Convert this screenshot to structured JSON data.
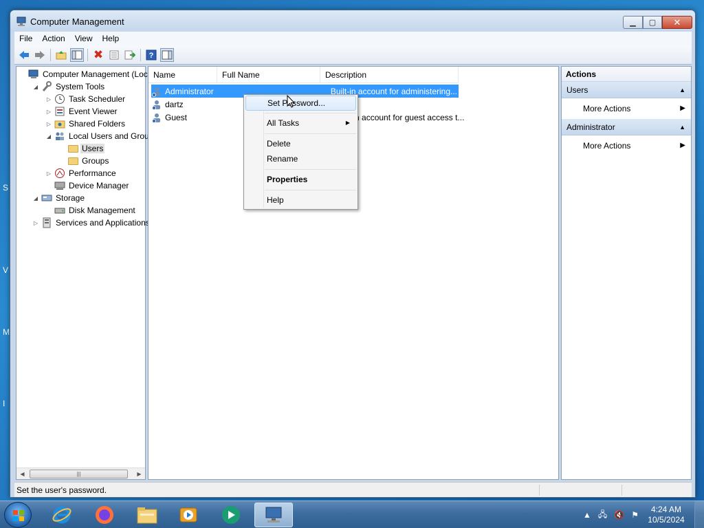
{
  "window": {
    "title": "Computer Management",
    "menu": [
      "File",
      "Action",
      "View",
      "Help"
    ]
  },
  "tree": [
    {
      "label": "Computer Management (Local",
      "indent": 0,
      "exp": "",
      "icon": "computer-icon"
    },
    {
      "label": "System Tools",
      "indent": 1,
      "exp": "◢",
      "icon": "tools-icon"
    },
    {
      "label": "Task Scheduler",
      "indent": 2,
      "exp": "▷",
      "icon": "clock-icon"
    },
    {
      "label": "Event Viewer",
      "indent": 2,
      "exp": "▷",
      "icon": "event-viewer-icon"
    },
    {
      "label": "Shared Folders",
      "indent": 2,
      "exp": "▷",
      "icon": "shared-folder-icon"
    },
    {
      "label": "Local Users and Groups",
      "indent": 2,
      "exp": "◢",
      "icon": "users-group-icon"
    },
    {
      "label": "Users",
      "indent": 3,
      "exp": "",
      "icon": "folder-icon",
      "selected": true
    },
    {
      "label": "Groups",
      "indent": 3,
      "exp": "",
      "icon": "folder-icon"
    },
    {
      "label": "Performance",
      "indent": 2,
      "exp": "▷",
      "icon": "performance-icon"
    },
    {
      "label": "Device Manager",
      "indent": 2,
      "exp": "",
      "icon": "device-manager-icon"
    },
    {
      "label": "Storage",
      "indent": 1,
      "exp": "◢",
      "icon": "storage-icon"
    },
    {
      "label": "Disk Management",
      "indent": 2,
      "exp": "",
      "icon": "disk-icon"
    },
    {
      "label": "Services and Applications",
      "indent": 1,
      "exp": "▷",
      "icon": "services-icon"
    }
  ],
  "list": {
    "columns": [
      "Name",
      "Full Name",
      "Description"
    ],
    "rows": [
      {
        "name": "Administrator",
        "full_name": "",
        "description": "Built-in account for administering...",
        "selected": true
      },
      {
        "name": "dartz",
        "full_name": "",
        "description": ""
      },
      {
        "name": "Guest",
        "full_name": "",
        "description": "Built-in account for guest access t..."
      }
    ]
  },
  "actions": {
    "header": "Actions",
    "sections": [
      {
        "title": "Users",
        "items": [
          "More Actions"
        ]
      },
      {
        "title": "Administrator",
        "items": [
          "More Actions"
        ]
      }
    ]
  },
  "context_menu": {
    "items": [
      "Set Password...",
      "All Tasks",
      "Delete",
      "Rename",
      "Properties",
      "Help"
    ]
  },
  "status": "Set the user's password.",
  "taskbar": {
    "apps": [
      "start-button",
      "internet-explorer-icon",
      "firefox-icon",
      "file-explorer-icon",
      "media-player-icon",
      "app-icon",
      "computer-management-icon"
    ],
    "clock_time": "4:24 AM",
    "clock_date": "10/5/2024"
  },
  "colors": {
    "selection": "#3399ff",
    "window_frame": "#c8d8ea",
    "taskbar": "#3d6c9e"
  }
}
